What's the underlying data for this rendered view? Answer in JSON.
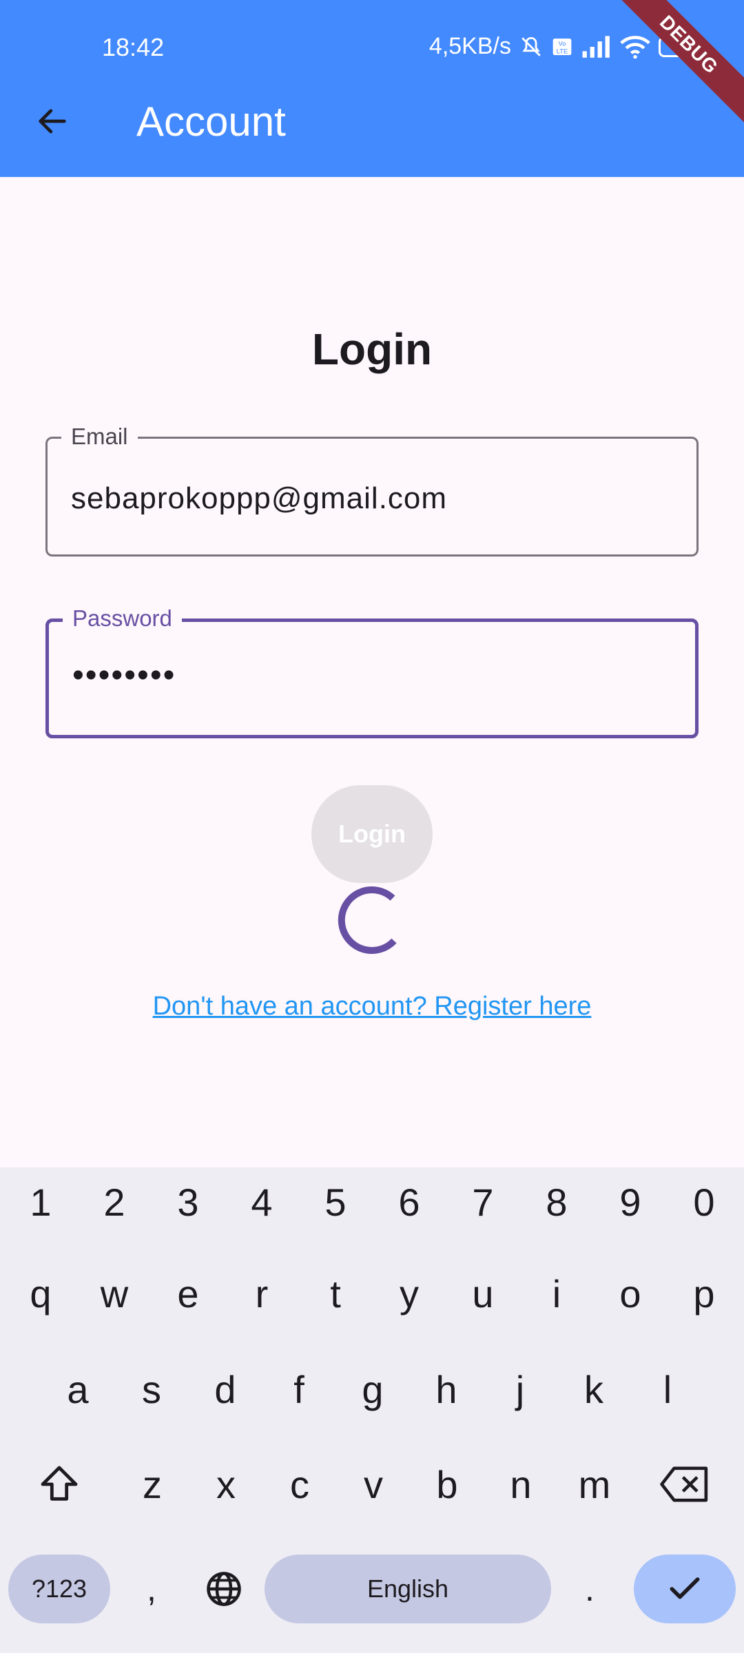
{
  "status_bar": {
    "time": "18:42",
    "speed": "4,5KB/s",
    "battery": "80",
    "icons": [
      "mute-bell-icon",
      "volte-icon",
      "signal-icon",
      "wifi-icon",
      "battery-icon"
    ]
  },
  "debug_banner": "DEBUG",
  "app_bar": {
    "title": "Account",
    "back_icon": "arrow-back-icon"
  },
  "login": {
    "title": "Login",
    "email": {
      "label": "Email",
      "value": "sebaprokoppp@gmail.com"
    },
    "password": {
      "label": "Password",
      "value": "••••••••"
    },
    "button_label": "Login",
    "register_link": "Don't have an account? Register here"
  },
  "keyboard": {
    "number_row": [
      "1",
      "2",
      "3",
      "4",
      "5",
      "6",
      "7",
      "8",
      "9",
      "0"
    ],
    "row1": [
      "q",
      "w",
      "e",
      "r",
      "t",
      "y",
      "u",
      "i",
      "o",
      "p"
    ],
    "row2": [
      "a",
      "s",
      "d",
      "f",
      "g",
      "h",
      "j",
      "k",
      "l"
    ],
    "row3": [
      "z",
      "x",
      "c",
      "v",
      "b",
      "n",
      "m"
    ],
    "symbols_key": "?123",
    "comma_key": ",",
    "space_label": "English",
    "period_key": "."
  },
  "colors": {
    "app_bar": "#448aff",
    "accent": "#6750a4",
    "link": "#2196f3",
    "keyboard_bg": "#eeedf4"
  }
}
